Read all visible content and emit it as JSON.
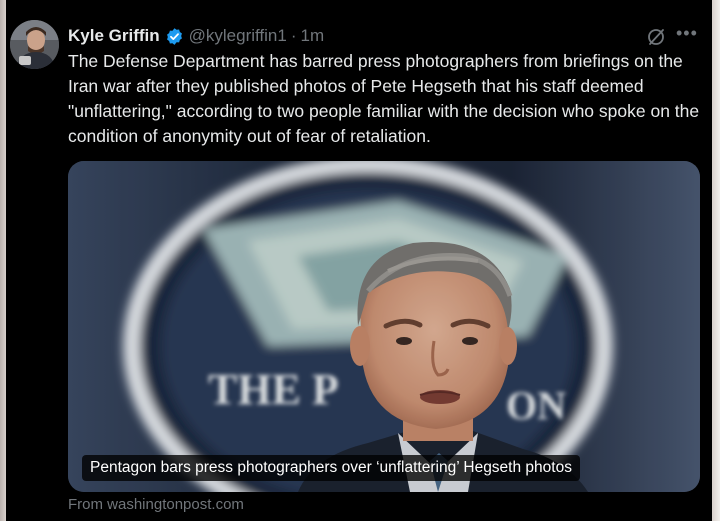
{
  "author": {
    "name": "Kyle Griffin",
    "handle": "@kylegriffin1",
    "separator": "·",
    "time": "1m"
  },
  "tweet": {
    "text": "The Defense Department has barred press photographers from briefings on the Iran war after they published photos of Pete Hegseth that his staff deemed \"unflattering,\" according to two people familiar with the decision who spoke on the condition of anonymity out of fear of retaliation."
  },
  "link_card": {
    "headline": "Pentagon bars press photographers over ‘unflattering’ Hegseth photos",
    "source": "From washingtonpost.com",
    "seal_text": "THE PENTAGON"
  },
  "icons": {
    "verified": "verified-badge-icon",
    "grok": "grok-icon",
    "more": "more-options-icon"
  },
  "colors": {
    "background": "#000000",
    "text": "#e7e9ea",
    "muted": "#71767b",
    "verified": "#1d9bf0"
  }
}
